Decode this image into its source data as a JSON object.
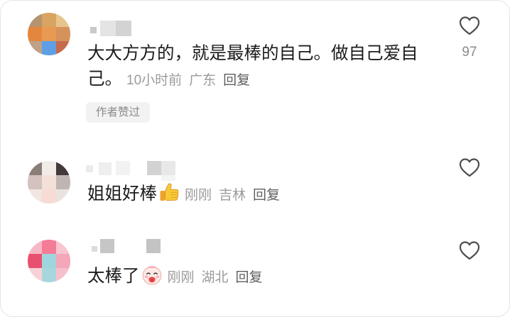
{
  "icons": {
    "like": "heart-outline-icon"
  },
  "comments": [
    {
      "avatar_mosaic": [
        "#b5946f",
        "#d9a461",
        "#e7c48b",
        "#e3873f",
        "#e99a52",
        "#d6925b",
        "#bfa188",
        "#5e9fe6",
        "#c76b4d"
      ],
      "text": "大大方方的，就是最棒的自己。做自己爱自己。",
      "time": "10小时前",
      "location": "广东",
      "reply_label": "回复",
      "badge": "作者赞过",
      "like_count": "97"
    },
    {
      "avatar_mosaic": [
        "#8a7e79",
        "#f1ece8",
        "#43393a",
        "#d3c2bd",
        "#f5e0d8",
        "#bfb6b3",
        "#f2e6e2",
        "#f6dcd4",
        "#e9e3e0"
      ],
      "text": "姐姐好棒",
      "emoji": "thumbs-up-emoji",
      "time": "刚刚",
      "location": "吉林",
      "reply_label": "回复"
    },
    {
      "avatar_mosaic": [
        "#f7b8c5",
        "#f47c97",
        "#f9c5d0",
        "#e9506f",
        "#9fd5dc",
        "#f3a7b8",
        "#f8d1d8",
        "#a8d6dd",
        "#f6c0cb"
      ],
      "text": "太棒了",
      "emoji": "shy-face-emoji",
      "time": "刚刚",
      "location": "湖北",
      "reply_label": "回复"
    }
  ]
}
